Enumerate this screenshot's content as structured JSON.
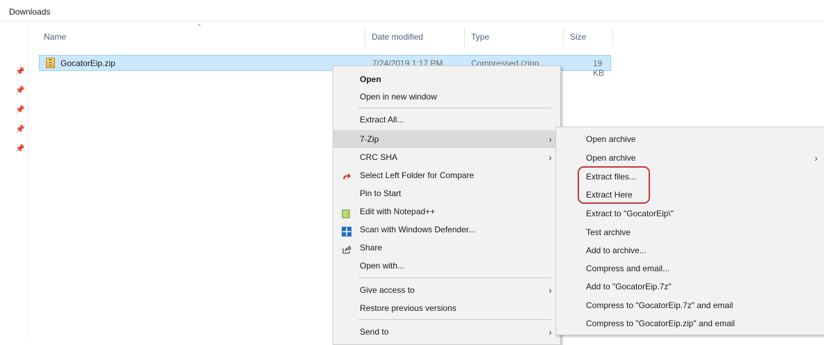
{
  "breadcrumb": "Downloads",
  "columns": {
    "name": "Name",
    "date_modified": "Date modified",
    "type": "Type",
    "size": "Size"
  },
  "file": {
    "name": "GocatorEip.zip",
    "date": "7/24/2019 1:17 PM",
    "type": "Compressed (zipp...",
    "size": "19 KB"
  },
  "context_menu": {
    "items": [
      {
        "label": "Open"
      },
      {
        "label": "Open in new window"
      },
      {
        "label": "Extract All..."
      },
      {
        "label": "7-Zip"
      },
      {
        "label": "CRC SHA"
      },
      {
        "label": "Select Left Folder for Compare"
      },
      {
        "label": "Pin to Start"
      },
      {
        "label": "Edit with Notepad++"
      },
      {
        "label": "Scan with Windows Defender..."
      },
      {
        "label": "Share"
      },
      {
        "label": "Open with..."
      },
      {
        "label": "Give access to"
      },
      {
        "label": "Restore previous versions"
      },
      {
        "label": "Send to"
      }
    ]
  },
  "submenu_7zip": {
    "items": [
      {
        "label": "Open archive"
      },
      {
        "label": "Open archive"
      },
      {
        "label": "Extract files..."
      },
      {
        "label": "Extract Here"
      },
      {
        "label": "Extract to \"GocatorEip\\\""
      },
      {
        "label": "Test archive"
      },
      {
        "label": "Add to archive..."
      },
      {
        "label": "Compress and email..."
      },
      {
        "label": "Add to \"GocatorEip.7z\""
      },
      {
        "label": "Compress to \"GocatorEip.7z\" and email"
      },
      {
        "label": "Compress to \"GocatorEip.zip\" and email"
      }
    ]
  },
  "colors": {
    "selection": "#cce8ff",
    "menu_bg": "#f2f2f2",
    "hover": "#dadada",
    "annotation": "#c0393b"
  }
}
